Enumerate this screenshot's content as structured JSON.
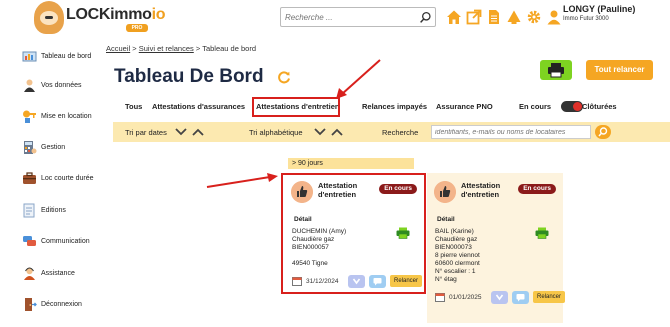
{
  "header": {
    "logo_text": "LOCKimmo",
    "logo_suffix": "io",
    "logo_sub": "PRO",
    "search_placeholder": "Recherche ...",
    "user_name": "LONGY (Pauline)",
    "user_org": "Immo Futur 3000",
    "icons": [
      "home-icon",
      "external-link-icon",
      "document-icon",
      "alert-icon",
      "gear-icon",
      "user-icon"
    ]
  },
  "sidebar": {
    "items": [
      {
        "label": "Tableau de bord",
        "icon": "dashboard-icon"
      },
      {
        "label": "Vos données",
        "icon": "person-icon"
      },
      {
        "label": "Mise en location",
        "icon": "key-icon"
      },
      {
        "label": "Gestion",
        "icon": "calculator-icon"
      },
      {
        "label": "Loc courte durée",
        "icon": "suitcase-icon"
      },
      {
        "label": "Editions",
        "icon": "doc-edit-icon"
      },
      {
        "label": "Communication",
        "icon": "chat-icon"
      },
      {
        "label": "Assistance",
        "icon": "support-icon"
      },
      {
        "label": "Déconnexion",
        "icon": "logout-icon"
      }
    ]
  },
  "breadcrumb": {
    "items": [
      "Accueil",
      "Suivi et relances",
      "Tableau de bord"
    ],
    "separator": " > "
  },
  "page": {
    "title": "Tableau De Bord",
    "relancer_all": "Tout relancer"
  },
  "tabs": {
    "items": [
      "Tous",
      "Attestations d'assurances",
      "Attestations d'entretien",
      "Relances impayés",
      "Assurance PNO"
    ],
    "active": "Attestations d'entretien",
    "toggle_left": "En cours",
    "toggle_right": "Clôturées"
  },
  "filters": {
    "sort_dates": "Tri par dates",
    "sort_alpha": "Tri alphabétique",
    "search_label": "Recherche",
    "search_placeholder": "identifiants, e-mails ou noms de locataires"
  },
  "section": {
    "label": "> 90 jours"
  },
  "cards": [
    {
      "type_line1": "Attestation",
      "type_line2": "d'entretien",
      "status": "En cours",
      "detail_label": "Détail",
      "lines": [
        "DUCHEMIN (Amy)",
        "Chaudière gaz",
        "BIEN000057",
        "",
        "49540 Tigne"
      ],
      "date": "31/12/2024",
      "relancer": "Relancer"
    },
    {
      "type_line1": "Attestation",
      "type_line2": "d'entretien",
      "status": "En cours",
      "detail_label": "Détail",
      "lines": [
        "BAIL (Karine)",
        "Chaudière gaz",
        "BIEN000073",
        "8 pierre viennot",
        "60600 clermont",
        "N° escalier : 1",
        "N° étag"
      ],
      "date": "01/01/2025",
      "relancer": "Relancer"
    }
  ],
  "colors": {
    "accent_orange": "#f5a623",
    "print_green": "#7ed321",
    "status_red": "#8b1a1a",
    "annotation_red": "#d8201c",
    "title_navy": "#1e2a44",
    "filter_bar": "#fce9b0"
  }
}
